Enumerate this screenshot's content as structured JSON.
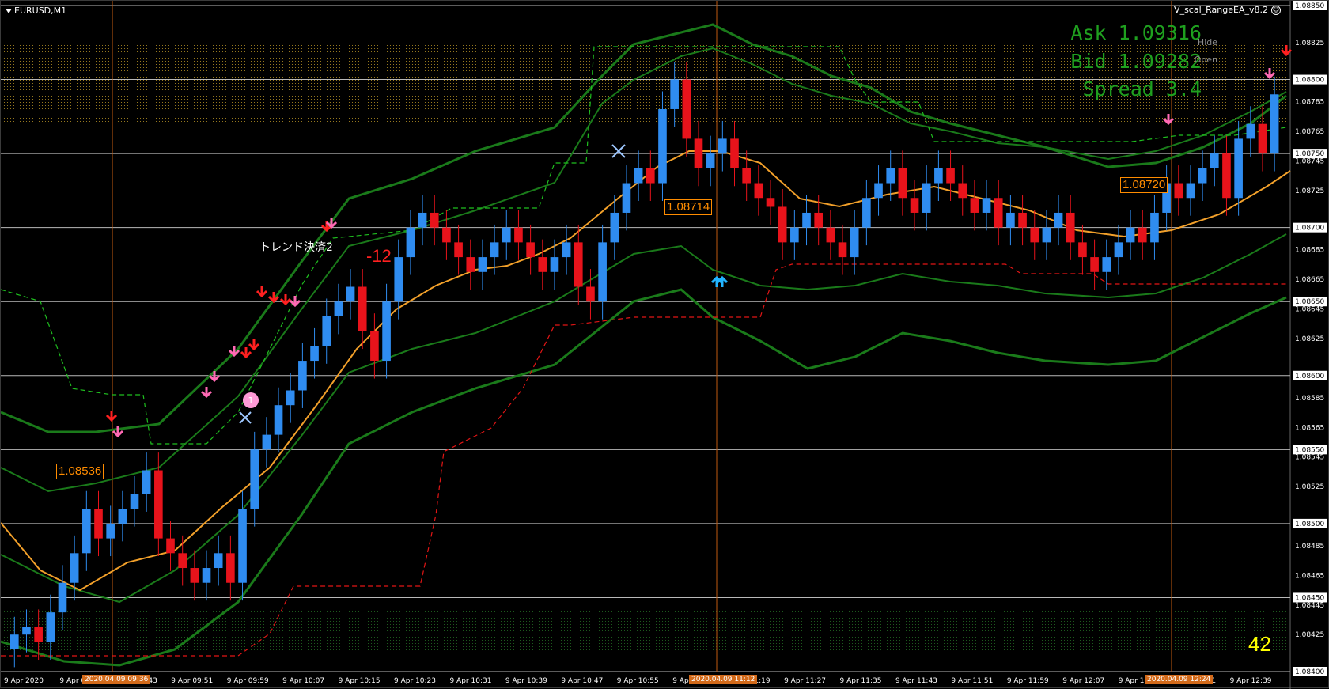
{
  "window": {
    "symbol_label": "EURUSD,M1",
    "ea_name": "V_scal_RangeEA_v8.2",
    "hide_label": "Hide",
    "open_label": "Open"
  },
  "quote": {
    "ask": "Ask 1.09316",
    "bid": "Bid 1.09282",
    "spread": "Spread 3.4"
  },
  "counter": "42",
  "annotations": {
    "label_1": "1.08536",
    "label_2": "1.08714",
    "label_3": "1.08720",
    "trend_text": "トレンド決済2",
    "red_number": "-12",
    "marker_1": "1"
  },
  "price_axis": {
    "ticks": [
      "1.08850",
      "1.08825",
      "1.08800",
      "1.08785",
      "1.08765",
      "1.08750",
      "1.08745",
      "1.08725",
      "1.08700",
      "1.08685",
      "1.08665",
      "1.08650",
      "1.08645",
      "1.08625",
      "1.08600",
      "1.08585",
      "1.08565",
      "1.08550",
      "1.08545",
      "1.08525",
      "1.08500",
      "1.08485",
      "1.08465",
      "1.08450",
      "1.08445",
      "1.08425",
      "1.08400"
    ],
    "highlighted": [
      "1.08850",
      "1.08800",
      "1.08750",
      "1.08700",
      "1.08650",
      "1.08600",
      "1.08550",
      "1.08500",
      "1.08450",
      "1.08400"
    ]
  },
  "time_axis": {
    "ticks": [
      "9 Apr 2020",
      "9 Apr 09:",
      "9 Apr 09:43",
      "9 Apr 09:51",
      "9 Apr 09:59",
      "9 Apr 10:07",
      "9 Apr 10:15",
      "9 Apr 10:23",
      "9 Apr 10:31",
      "9 Apr 10:39",
      "9 Apr 10:47",
      "9 Apr 10:55",
      "9 Apr 11",
      "9 Apr 11:19",
      "9 Apr 11:27",
      "9 Apr 11:35",
      "9 Apr 11:43",
      "9 Apr 11:51",
      "9 Apr 11:59",
      "9 Apr 12:07",
      "9 Apr 12",
      "9 Apr 12:31",
      "9 Apr 12:39"
    ],
    "highlighted": [
      "2020.04.09 09:36",
      "2020.04.09 11:12",
      "2020.04.09 12:24"
    ]
  },
  "colors": {
    "bull": "#2f8cf0",
    "bear": "#e8131b",
    "band": "#1a7a1a",
    "ma": "#f2a02a",
    "vline": "#c05a10",
    "hline": "#b9b9b9",
    "buy_arrow": "#22b4ff",
    "sell_arrow": "#ff69b4"
  },
  "chart_data": {
    "type": "candlestick",
    "symbol": "EURUSD",
    "timeframe": "M1",
    "ylim": [
      1.084,
      1.0885
    ],
    "close_series": [
      1.08425,
      1.0843,
      1.0842,
      1.0844,
      1.0846,
      1.0848,
      1.0851,
      1.0849,
      1.085,
      1.0851,
      1.0852,
      1.08536,
      1.0849,
      1.0848,
      1.0847,
      1.0846,
      1.0847,
      1.0848,
      1.0846,
      1.0851,
      1.0855,
      1.0856,
      1.0858,
      1.0859,
      1.0861,
      1.0862,
      1.0864,
      1.0865,
      1.0866,
      1.0863,
      1.0861,
      1.0865,
      1.0868,
      1.087,
      1.0871,
      1.087,
      1.0869,
      1.0868,
      1.0867,
      1.0868,
      1.0869,
      1.087,
      1.0869,
      1.0868,
      1.0867,
      1.0868,
      1.0869,
      1.0866,
      1.0865,
      1.0869,
      1.0871,
      1.0873,
      1.0874,
      1.0873,
      1.0878,
      1.088,
      1.0876,
      1.0874,
      1.0875,
      1.0876,
      1.0874,
      1.0873,
      1.0872,
      1.08714,
      1.0869,
      1.087,
      1.0871,
      1.087,
      1.0869,
      1.0868,
      1.087,
      1.0872,
      1.0873,
      1.0874,
      1.0872,
      1.0871,
      1.0873,
      1.0874,
      1.0873,
      1.0872,
      1.0871,
      1.0872,
      1.087,
      1.0871,
      1.087,
      1.0869,
      1.087,
      1.0871,
      1.0869,
      1.0868,
      1.0867,
      1.0868,
      1.0869,
      1.087,
      1.0869,
      1.0871,
      1.0873,
      1.0872,
      1.0873,
      1.0874,
      1.0875,
      1.0872,
      1.0876,
      1.0877,
      1.0875,
      1.0879
    ]
  }
}
